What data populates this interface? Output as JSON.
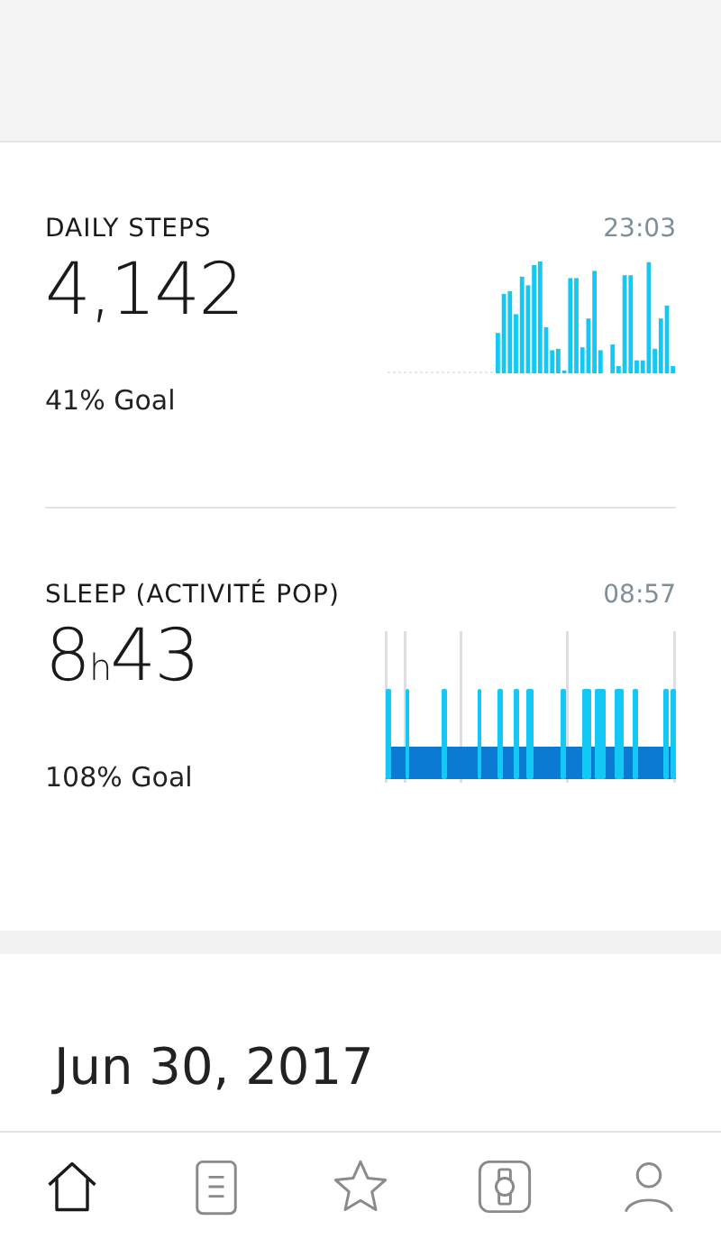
{
  "metrics": [
    {
      "kind": "steps",
      "title": "DAILY STEPS",
      "time": "23:03",
      "value": "4,142",
      "goal": "41% Goal"
    },
    {
      "kind": "sleep",
      "title": "SLEEP (ACTIVITÉ POP)",
      "time": "08:57",
      "value": "8$_{h}$43",
      "goal": "108% Goal"
    }
  ],
  "date": "Jun 30, 2017",
  "nav": [
    {
      "kind": "home",
      "selected": true
    },
    {
      "kind": "list",
      "selected": false
    },
    {
      "kind": "star",
      "selected": false
    },
    {
      "kind": "watch",
      "selected": false
    },
    {
      "kind": "profile",
      "selected": false
    }
  ]
}
